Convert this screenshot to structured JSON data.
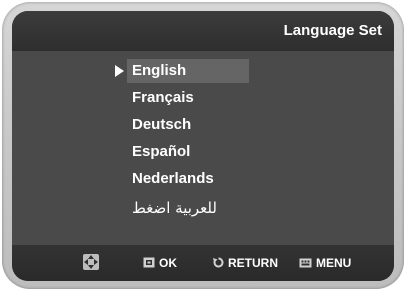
{
  "header": {
    "title": "Language Set"
  },
  "languages": {
    "selected_index": 0,
    "items": [
      {
        "label": "English"
      },
      {
        "label": "Français"
      },
      {
        "label": "Deutsch"
      },
      {
        "label": "Español"
      },
      {
        "label": "Nederlands"
      },
      {
        "label": "للعربية اضغط"
      }
    ]
  },
  "footer": {
    "nav_icon": "directional-pad-icon",
    "ok_icon": "enter-key-icon",
    "ok_label": "OK",
    "return_icon": "return-arrow-icon",
    "return_label": "RETURN",
    "menu_icon": "menu-key-icon",
    "menu_label": "MENU"
  },
  "colors": {
    "screen_background": "#4a4a4a",
    "title_bar": "#333333",
    "selection_highlight": "#656565",
    "text": "#ffffff",
    "bezel": "#cccccc"
  }
}
